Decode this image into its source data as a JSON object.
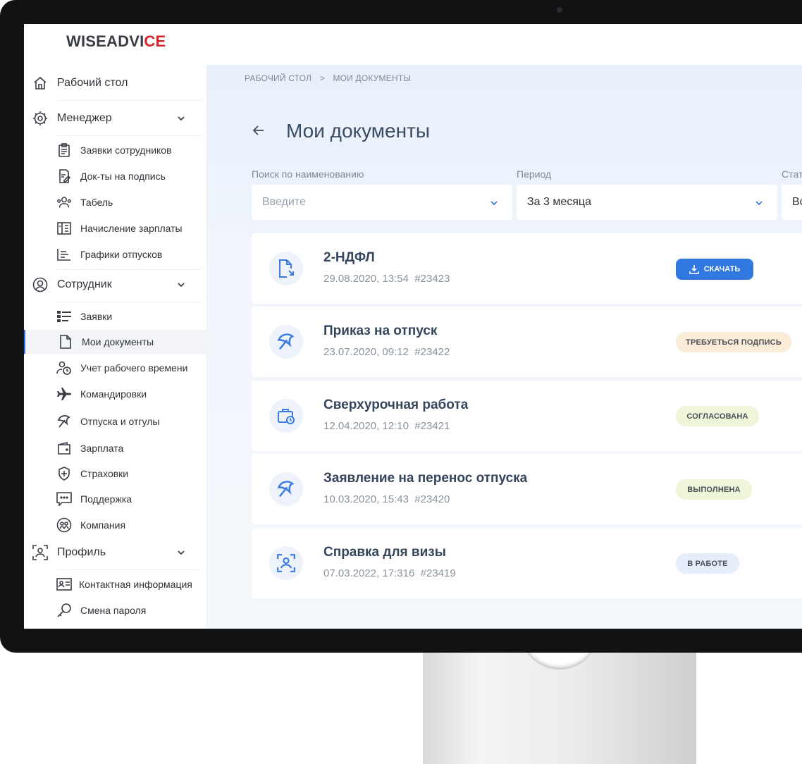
{
  "logo": {
    "text_a": "WISEADVI",
    "text_b": "CE"
  },
  "sidebar": {
    "desk": "Рабочий стол",
    "manager": {
      "label": "Менеджер",
      "items": [
        "Заявки сотрудников",
        "Док-ты на подпись",
        "Табель",
        "Начисление зарплаты",
        "Графики отпусков"
      ]
    },
    "employee": {
      "label": "Сотрудник",
      "items": [
        "Заявки",
        "Мои документы",
        "Учет рабочего времени",
        "Командировки",
        "Отпуска и отгулы",
        "Зарплата",
        "Страховки",
        "Поддержка",
        "Компания"
      ]
    },
    "profile": {
      "label": "Профиль",
      "items": [
        "Контактная информация",
        "Смена пароля"
      ]
    }
  },
  "breadcrumb": {
    "home": "РАБОЧИЙ СТОЛ",
    "sep": ">",
    "current": "МОИ ДОКУМЕНТЫ"
  },
  "page_title": "Мои документы",
  "filters": {
    "search_label": "Поиск по наименованию",
    "search_placeholder": "Введите",
    "period_label": "Период",
    "period_value": "За 3 месяца",
    "status_label": "Стат",
    "status_value": "Вс"
  },
  "documents": [
    {
      "title": "2-НДФЛ",
      "date": "29.08.2020, 13:54",
      "num": "#23423",
      "action": "СКАЧАТЬ",
      "icon": "document-download-icon"
    },
    {
      "title": "Приказ на отпуск",
      "date": "23.07.2020, 09:12",
      "num": "#23422",
      "status": "ТРЕБУЕТЬСЯ ПОДПИСЬ",
      "status_bg": "#fbecd8",
      "icon": "umbrella-icon"
    },
    {
      "title": "Сверхурочная работа",
      "date": "12.04.2020, 12:10",
      "num": "#23421",
      "status": "СОГЛАСОВАНА",
      "status_bg": "#eef5d9",
      "icon": "briefcase-clock-icon"
    },
    {
      "title": "Заявление на перенос отпуска",
      "date": "10.03.2020, 15:43",
      "num": "#23420",
      "status": "ВЫПОЛНЕНА",
      "status_bg": "#eef5d9",
      "icon": "umbrella-icon"
    },
    {
      "title": "Справка для визы",
      "date": "07.03.2022, 17:316",
      "num": "#23419",
      "status": "В РАБОТЕ",
      "status_bg": "#e6eefb",
      "icon": "user-scan-icon"
    }
  ],
  "colors": {
    "accent": "#3178e0",
    "brand_red": "#d8232a"
  }
}
